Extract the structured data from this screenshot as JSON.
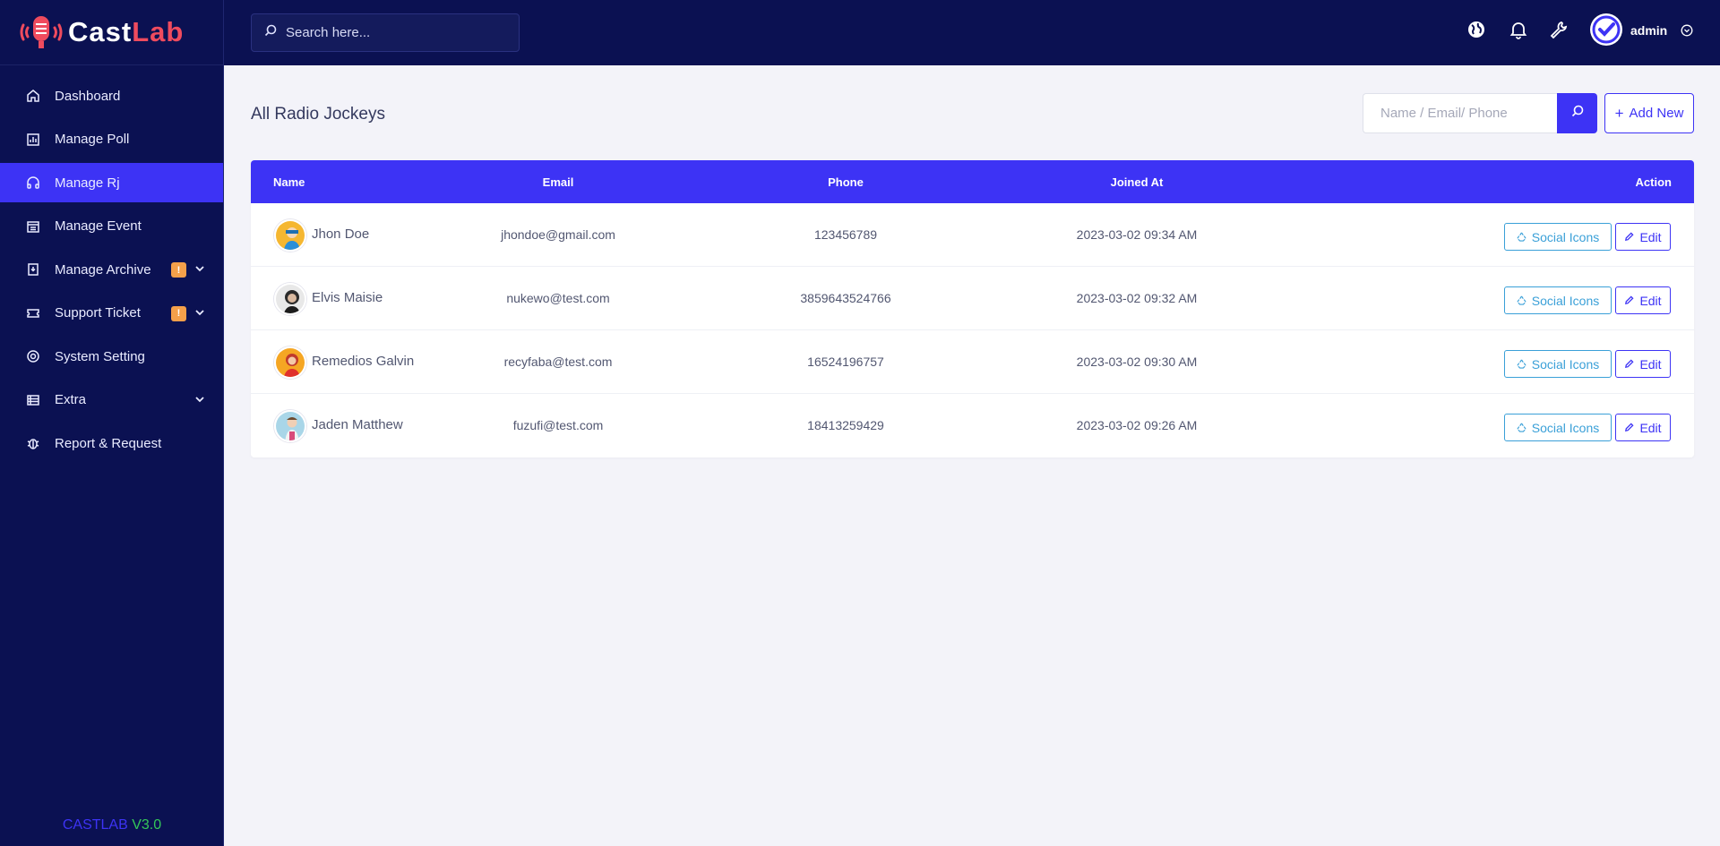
{
  "brand": {
    "name_part1": "Cast",
    "name_part2": "Lab",
    "primary": "#3d33f5",
    "dark": "#0b1152",
    "accent": "#ef4b5e"
  },
  "sidebar": {
    "items": [
      {
        "label": "Dashboard",
        "icon": "home-icon"
      },
      {
        "label": "Manage Poll",
        "icon": "chart-icon"
      },
      {
        "label": "Manage Rj",
        "icon": "headphones-icon",
        "active": true
      },
      {
        "label": "Manage Event",
        "icon": "calendar-icon"
      },
      {
        "label": "Manage Archive",
        "icon": "archive-icon",
        "badge": "!"
      },
      {
        "label": "Support Ticket",
        "icon": "ticket-icon",
        "badge": "!"
      },
      {
        "label": "System Setting",
        "icon": "settings-icon"
      },
      {
        "label": "Extra",
        "icon": "list-icon"
      },
      {
        "label": "Report & Request",
        "icon": "bug-icon"
      }
    ],
    "version_name": "CASTLAB",
    "version_number": "V3.0"
  },
  "topbar": {
    "search_placeholder": "Search here...",
    "user_name": "admin"
  },
  "main": {
    "title": "All Radio Jockeys",
    "filter_placeholder": "Name / Email/ Phone",
    "add_new_label": "Add New",
    "table": {
      "headers": {
        "name": "Name",
        "email": "Email",
        "phone": "Phone",
        "joined": "Joined At",
        "action": "Action"
      },
      "rows": [
        {
          "name": "Jhon Doe",
          "email": "jhondoe@gmail.com",
          "phone": "123456789",
          "joined": "2023-03-02 09:34 AM"
        },
        {
          "name": "Elvis Maisie",
          "email": "nukewo@test.com",
          "phone": "3859643524766",
          "joined": "2023-03-02 09:32 AM"
        },
        {
          "name": "Remedios Galvin",
          "email": "recyfaba@test.com",
          "phone": "16524196757",
          "joined": "2023-03-02 09:30 AM"
        },
        {
          "name": "Jaden Matthew",
          "email": "fuzufi@test.com",
          "phone": "18413259429",
          "joined": "2023-03-02 09:26 AM"
        }
      ],
      "social_label": "Social Icons",
      "edit_label": "Edit"
    }
  }
}
